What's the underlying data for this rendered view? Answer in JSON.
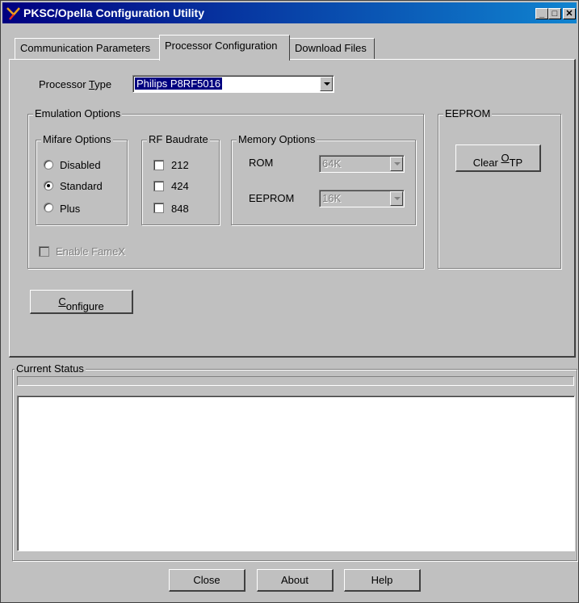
{
  "window": {
    "title": "PKSC/Opella Configuration Utility",
    "minimize_glyph": "_",
    "maximize_glyph": "□",
    "close_glyph": "✕"
  },
  "tabs": [
    {
      "label": "Communication Parameters"
    },
    {
      "label": "Processor Configuration"
    },
    {
      "label": "Download Files"
    }
  ],
  "processor": {
    "label_pre": "Processor ",
    "label_key": "T",
    "label_post": "ype",
    "selected": "Philips P8RF5016"
  },
  "emulation": {
    "title": "Emulation Options",
    "mifare": {
      "title": "Mifare Options",
      "options": [
        "Disabled",
        "Standard",
        "Plus"
      ],
      "selected": "Standard"
    },
    "rf": {
      "title": "RF Baudrate",
      "options": [
        "212",
        "424",
        "848"
      ]
    },
    "memory": {
      "title": "Memory Options",
      "rom_label": "ROM",
      "rom_value": "64K",
      "eeprom_label": "EEPROM",
      "eeprom_value": "16K"
    },
    "famex_label": "Enable FameX"
  },
  "eeprom": {
    "title": "EEPROM",
    "clear_pre": "Clear ",
    "clear_key": "O",
    "clear_post": "TP"
  },
  "configure": {
    "key": "C",
    "rest": "onfigure"
  },
  "status": {
    "title": "Current Status"
  },
  "footer": {
    "close": "Close",
    "about": "About",
    "help": "Help"
  }
}
